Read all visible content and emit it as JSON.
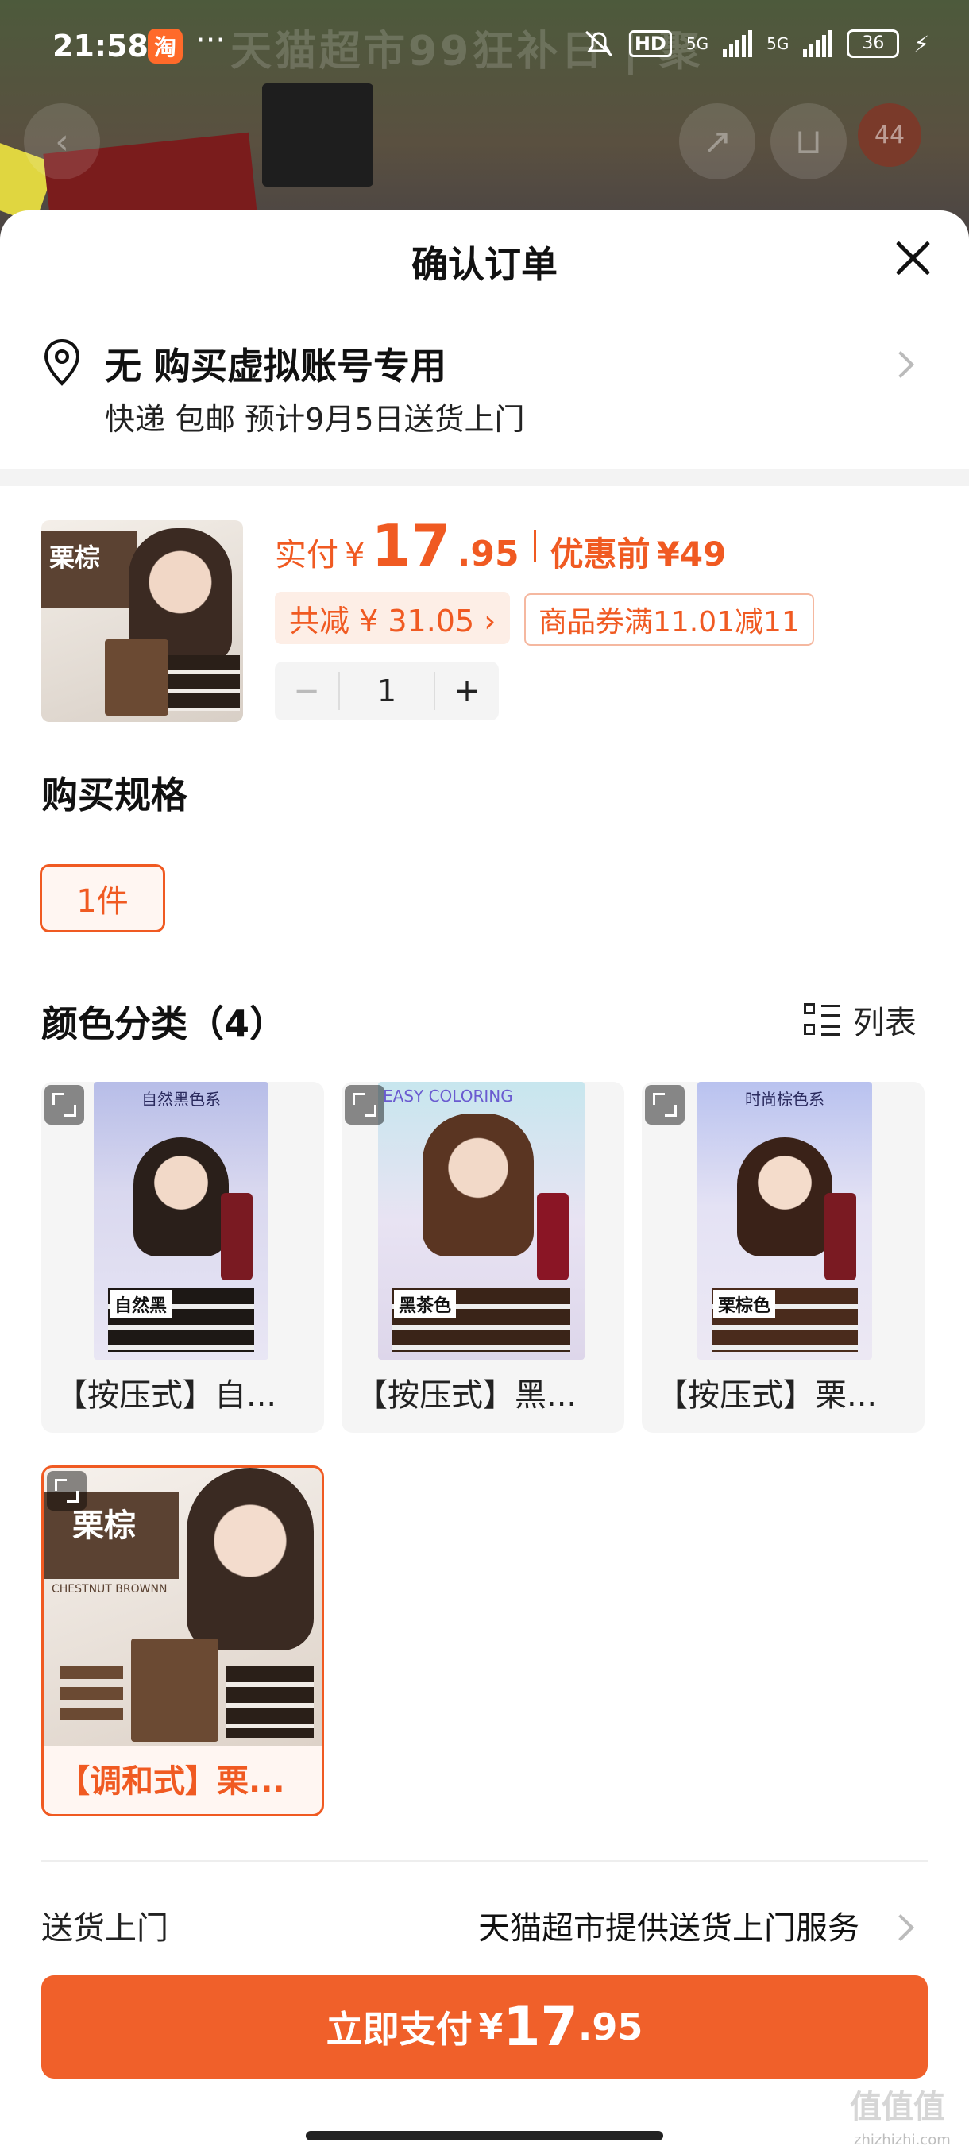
{
  "status_bar": {
    "time": "21:58",
    "app_icon_glyph": "淘",
    "more": "···",
    "hd": "HD",
    "net1": "5G",
    "net2": "5G",
    "battery": "36"
  },
  "background": {
    "banner": "天猫超市99狂补日 | 聚",
    "badge": "44"
  },
  "sheet": {
    "title": "确认订单"
  },
  "address": {
    "name": "无 购买虚拟账号专用",
    "delivery_line": "快递 包邮 预计9月5日送货上门"
  },
  "product": {
    "thumb_tag": "栗棕",
    "price_label": "实付",
    "currency": "¥",
    "price_int": "17",
    "price_dec": ".95",
    "original_label": "优惠前",
    "original_price": "¥49",
    "discount_pill": "共减 ¥ 31.05 ›",
    "coupon_pill": "商品券满11.01减11",
    "qty_minus": "−",
    "qty": "1",
    "qty_plus": "+"
  },
  "spec": {
    "heading": "购买规格",
    "option": "1件"
  },
  "colors": {
    "heading": "颜色分类（4）",
    "list_toggle": "列表",
    "items": [
      {
        "caption": "【按压式】自...",
        "poster_name": "自然黑",
        "poster_head": "自然黑色系"
      },
      {
        "caption": "【按压式】黑...",
        "poster_name": "黑茶色",
        "poster_head": "EASY COLORING"
      },
      {
        "caption": "【按压式】栗...",
        "poster_name": "栗棕色",
        "poster_head": "时尚棕色系"
      },
      {
        "caption": "【调和式】栗...",
        "poster_name": "栗棕",
        "poster_head": "CHESTNUT BROWNN"
      }
    ]
  },
  "delivery": {
    "label": "送货上门",
    "value": "天猫超市提供送货上门服务"
  },
  "pay_button": {
    "label": "立即支付",
    "currency": "¥",
    "int": "17",
    "dec": ".95"
  },
  "watermark": {
    "text": "值值值",
    "sub": "zhizhizhi.com"
  },
  "colors_theme": {
    "accent": "#f05a22",
    "pay": "#f0602a"
  }
}
